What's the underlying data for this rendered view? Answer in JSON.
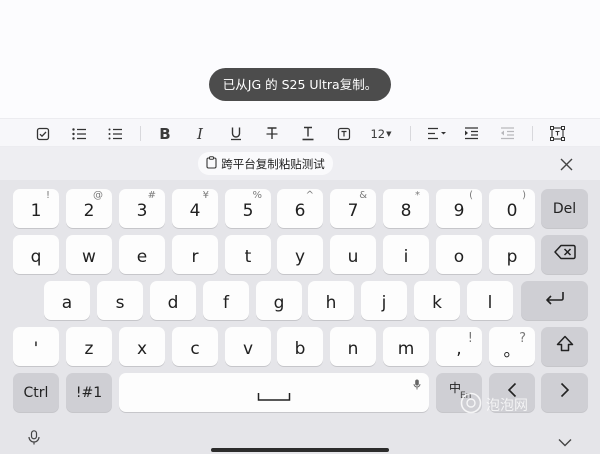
{
  "toast": {
    "text": "已从JG 的 S25 Ultra复制。"
  },
  "toolbar": {
    "font_size": "12",
    "items": [
      "checkbox-list",
      "bullet-list",
      "dotted-list",
      "bold",
      "italic",
      "underline",
      "strikethrough",
      "text-color",
      "text-box",
      "font-size",
      "align",
      "indent",
      "outdent",
      "text-frame"
    ]
  },
  "clipboard": {
    "chip_text": "跨平台复制粘贴测试"
  },
  "keyboard": {
    "row1": [
      {
        "main": "1",
        "sub": "!"
      },
      {
        "main": "2",
        "sub": "@"
      },
      {
        "main": "3",
        "sub": "#"
      },
      {
        "main": "4",
        "sub": "¥"
      },
      {
        "main": "5",
        "sub": "%"
      },
      {
        "main": "6",
        "sub": "^"
      },
      {
        "main": "7",
        "sub": "&"
      },
      {
        "main": "8",
        "sub": "*"
      },
      {
        "main": "9",
        "sub": "("
      },
      {
        "main": "0",
        "sub": ")"
      }
    ],
    "del_label": "Del",
    "row2": [
      "q",
      "w",
      "e",
      "r",
      "t",
      "y",
      "u",
      "i",
      "o",
      "p"
    ],
    "row3": [
      "a",
      "s",
      "d",
      "f",
      "g",
      "h",
      "j",
      "k",
      "l"
    ],
    "row4": [
      {
        "main": "'",
        "sub": ""
      },
      {
        "main": "z",
        "sub": ""
      },
      {
        "main": "x",
        "sub": ""
      },
      {
        "main": "c",
        "sub": ""
      },
      {
        "main": "v",
        "sub": ""
      },
      {
        "main": "b",
        "sub": ""
      },
      {
        "main": "n",
        "sub": ""
      },
      {
        "main": "m",
        "sub": ""
      },
      {
        "main": ",",
        "sub": "!"
      },
      {
        "main": "。",
        "sub": "?"
      }
    ],
    "ctrl_label": "Ctrl",
    "sym_label": "!#1",
    "lang_main": "中",
    "lang_sub": "En"
  },
  "watermark": {
    "text": "泡泡网"
  },
  "colors": {
    "keyboard_bg": "#e5e5e9",
    "key_bg": "#fdfdfd",
    "fn_key_bg": "#cfcfd4",
    "toast_bg": "#4c4c4c"
  }
}
